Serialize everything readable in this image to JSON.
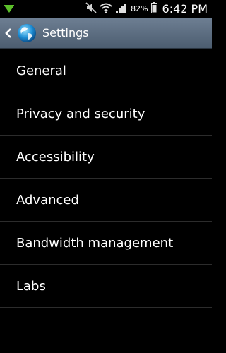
{
  "status_bar": {
    "notification_icon": "download-arrow-icon",
    "mute_icon": "mute-icon",
    "wifi_icon": "wifi-icon",
    "signal_icon": "signal-icon",
    "battery_percent": "82%",
    "battery_icon": "battery-icon",
    "time": "6:42 PM"
  },
  "action_bar": {
    "back_icon": "chevron-left-icon",
    "app_icon": "globe-icon",
    "title": "Settings"
  },
  "settings": {
    "items": [
      {
        "label": "General"
      },
      {
        "label": "Privacy and security"
      },
      {
        "label": "Accessibility"
      },
      {
        "label": "Advanced"
      },
      {
        "label": "Bandwidth management"
      },
      {
        "label": "Labs"
      }
    ]
  },
  "colors": {
    "background": "#000000",
    "action_bar_top": "#6e7f93",
    "action_bar_bottom": "#4c5d70",
    "divider": "#2c2c2c",
    "text": "#ffffff",
    "notification_green": "#5cbf2a"
  }
}
